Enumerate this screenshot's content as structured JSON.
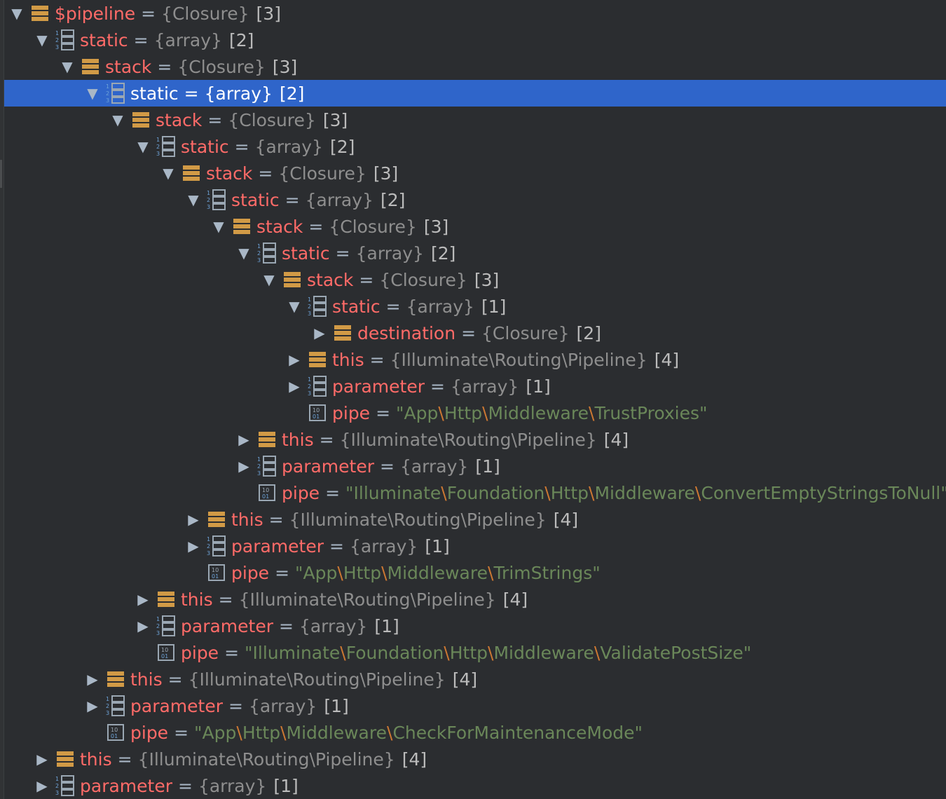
{
  "rows": [
    {
      "indent": 0,
      "toggle": "expanded",
      "icon": "object-icon",
      "name": "$pipeline",
      "type": "{Closure}",
      "count": "[3]"
    },
    {
      "indent": 1,
      "toggle": "expanded",
      "icon": "array-icon",
      "name": "static",
      "type": "{array}",
      "count": "[2]"
    },
    {
      "indent": 2,
      "toggle": "expanded",
      "icon": "object-icon",
      "name": "stack",
      "type": "{Closure}",
      "count": "[3]"
    },
    {
      "indent": 3,
      "toggle": "expanded",
      "icon": "array-icon",
      "name": "static",
      "type": "{array}",
      "count": "[2]",
      "selected": true
    },
    {
      "indent": 4,
      "toggle": "expanded",
      "icon": "object-icon",
      "name": "stack",
      "type": "{Closure}",
      "count": "[3]"
    },
    {
      "indent": 5,
      "toggle": "expanded",
      "icon": "array-icon",
      "name": "static",
      "type": "{array}",
      "count": "[2]"
    },
    {
      "indent": 6,
      "toggle": "expanded",
      "icon": "object-icon",
      "name": "stack",
      "type": "{Closure}",
      "count": "[3]"
    },
    {
      "indent": 7,
      "toggle": "expanded",
      "icon": "array-icon",
      "name": "static",
      "type": "{array}",
      "count": "[2]"
    },
    {
      "indent": 8,
      "toggle": "expanded",
      "icon": "object-icon",
      "name": "stack",
      "type": "{Closure}",
      "count": "[3]"
    },
    {
      "indent": 9,
      "toggle": "expanded",
      "icon": "array-icon",
      "name": "static",
      "type": "{array}",
      "count": "[2]"
    },
    {
      "indent": 10,
      "toggle": "expanded",
      "icon": "object-icon",
      "name": "stack",
      "type": "{Closure}",
      "count": "[3]"
    },
    {
      "indent": 11,
      "toggle": "expanded",
      "icon": "array-icon",
      "name": "static",
      "type": "{array}",
      "count": "[1]"
    },
    {
      "indent": 12,
      "toggle": "collapsed",
      "icon": "object-icon",
      "name": "destination",
      "type": "{Closure}",
      "count": "[2]"
    },
    {
      "indent": 11,
      "toggle": "collapsed",
      "icon": "object-icon",
      "name": "this",
      "type": "{Illuminate\\Routing\\Pipeline}",
      "count": "[4]"
    },
    {
      "indent": 11,
      "toggle": "collapsed",
      "icon": "array-icon",
      "name": "parameter",
      "type": "{array}",
      "count": "[1]"
    },
    {
      "indent": 11,
      "toggle": "leaf",
      "icon": "string-icon",
      "name": "pipe",
      "value": "\"App\\Http\\Middleware\\TrustProxies\""
    },
    {
      "indent": 9,
      "toggle": "collapsed",
      "icon": "object-icon",
      "name": "this",
      "type": "{Illuminate\\Routing\\Pipeline}",
      "count": "[4]"
    },
    {
      "indent": 9,
      "toggle": "collapsed",
      "icon": "array-icon",
      "name": "parameter",
      "type": "{array}",
      "count": "[1]"
    },
    {
      "indent": 9,
      "toggle": "leaf",
      "icon": "string-icon",
      "name": "pipe",
      "value": "\"Illuminate\\Foundation\\Http\\Middleware\\ConvertEmptyStringsToNull\""
    },
    {
      "indent": 7,
      "toggle": "collapsed",
      "icon": "object-icon",
      "name": "this",
      "type": "{Illuminate\\Routing\\Pipeline}",
      "count": "[4]"
    },
    {
      "indent": 7,
      "toggle": "collapsed",
      "icon": "array-icon",
      "name": "parameter",
      "type": "{array}",
      "count": "[1]"
    },
    {
      "indent": 7,
      "toggle": "leaf",
      "icon": "string-icon",
      "name": "pipe",
      "value": "\"App\\Http\\Middleware\\TrimStrings\""
    },
    {
      "indent": 5,
      "toggle": "collapsed",
      "icon": "object-icon",
      "name": "this",
      "type": "{Illuminate\\Routing\\Pipeline}",
      "count": "[4]"
    },
    {
      "indent": 5,
      "toggle": "collapsed",
      "icon": "array-icon",
      "name": "parameter",
      "type": "{array}",
      "count": "[1]"
    },
    {
      "indent": 5,
      "toggle": "leaf",
      "icon": "string-icon",
      "name": "pipe",
      "value": "\"Illuminate\\Foundation\\Http\\Middleware\\ValidatePostSize\""
    },
    {
      "indent": 3,
      "toggle": "collapsed",
      "icon": "object-icon",
      "name": "this",
      "type": "{Illuminate\\Routing\\Pipeline}",
      "count": "[4]"
    },
    {
      "indent": 3,
      "toggle": "collapsed",
      "icon": "array-icon",
      "name": "parameter",
      "type": "{array}",
      "count": "[1]"
    },
    {
      "indent": 3,
      "toggle": "leaf",
      "icon": "string-icon",
      "name": "pipe",
      "value": "\"App\\Http\\Middleware\\CheckForMaintenanceMode\""
    },
    {
      "indent": 1,
      "toggle": "collapsed",
      "icon": "object-icon",
      "name": "this",
      "type": "{Illuminate\\Routing\\Pipeline}",
      "count": "[4]"
    },
    {
      "indent": 1,
      "toggle": "collapsed",
      "icon": "array-icon",
      "name": "parameter",
      "type": "{array}",
      "count": "[1]"
    }
  ],
  "eq_sign": "=",
  "colors": {
    "background": "#2b2d30",
    "selection": "#2f65ca",
    "variable_name": "#ff6b68",
    "type": "#8e8e8e",
    "string_value": "#6a8759",
    "string_separator": "#cc7832",
    "object_icon": "#d19a46",
    "array_icon": "#9aa7b3"
  }
}
